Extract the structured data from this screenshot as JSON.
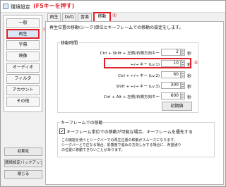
{
  "colors": {
    "accent_red": "#e0202a",
    "selected_bg": "#d8e8f6"
  },
  "window": {
    "title": "環境設定",
    "annotation": "(F5キーを押す)"
  },
  "nav": {
    "items": [
      {
        "label": "一般",
        "selected": false
      },
      {
        "label": "再生",
        "selected": true
      },
      {
        "label": "字幕",
        "selected": false
      },
      {
        "label": "映像",
        "selected": false
      },
      {
        "label": "オーディオ",
        "selected": false
      },
      {
        "label": "フィルタ",
        "selected": false
      },
      {
        "label": "アカウント",
        "selected": false
      },
      {
        "label": "その他",
        "selected": false
      }
    ],
    "marker": "①"
  },
  "side_buttons": {
    "init": "初期化",
    "backup": "環境設定バックアップ",
    "close": "閉じる"
  },
  "tabs": {
    "items": [
      {
        "label": "再生"
      },
      {
        "label": "DVD"
      },
      {
        "label": "音楽"
      },
      {
        "label": "移動"
      }
    ],
    "active": 3,
    "marker": "②"
  },
  "content": {
    "description": "再生位置の移動(シーク)単位とキーフレームでの移動の設定をします。",
    "move_time": {
      "group_label": "移動時間",
      "rows": [
        {
          "label": "Ctrl + Shift + 左側/右側方向キー",
          "value": "2",
          "unit": "秒"
        },
        {
          "label": "←/→ キー (Lv.1)",
          "value": "10",
          "unit": "秒"
        },
        {
          "label": "Ctrl + ←/→ キー (Lv.2)",
          "value": "60",
          "unit": "秒"
        },
        {
          "label": "Shift + ←/→ キー (Lv.3)",
          "value": "300",
          "unit": "秒"
        },
        {
          "label": "Ctrl + Alt + 左側/右側方向キー",
          "value": "600",
          "unit": "秒"
        }
      ],
      "row_marker": "③",
      "reset_label": "初期値"
    },
    "keyframe": {
      "group_label": "キーフレームでの移動",
      "checkbox_checked": true,
      "checkbox_mark": "✓",
      "checkbox_label": "キーフレーム単位での移動が可能な場合、キーフレームを優先する",
      "note_lines": [
        "この機能を使うとシークバーでの再生位置の移動がスムーズになります。",
        "シークバーとで正なる場合、影響度で進めの方向しかする場合に、希望通り",
        "の位置に移動できないことがあります。"
      ]
    }
  }
}
